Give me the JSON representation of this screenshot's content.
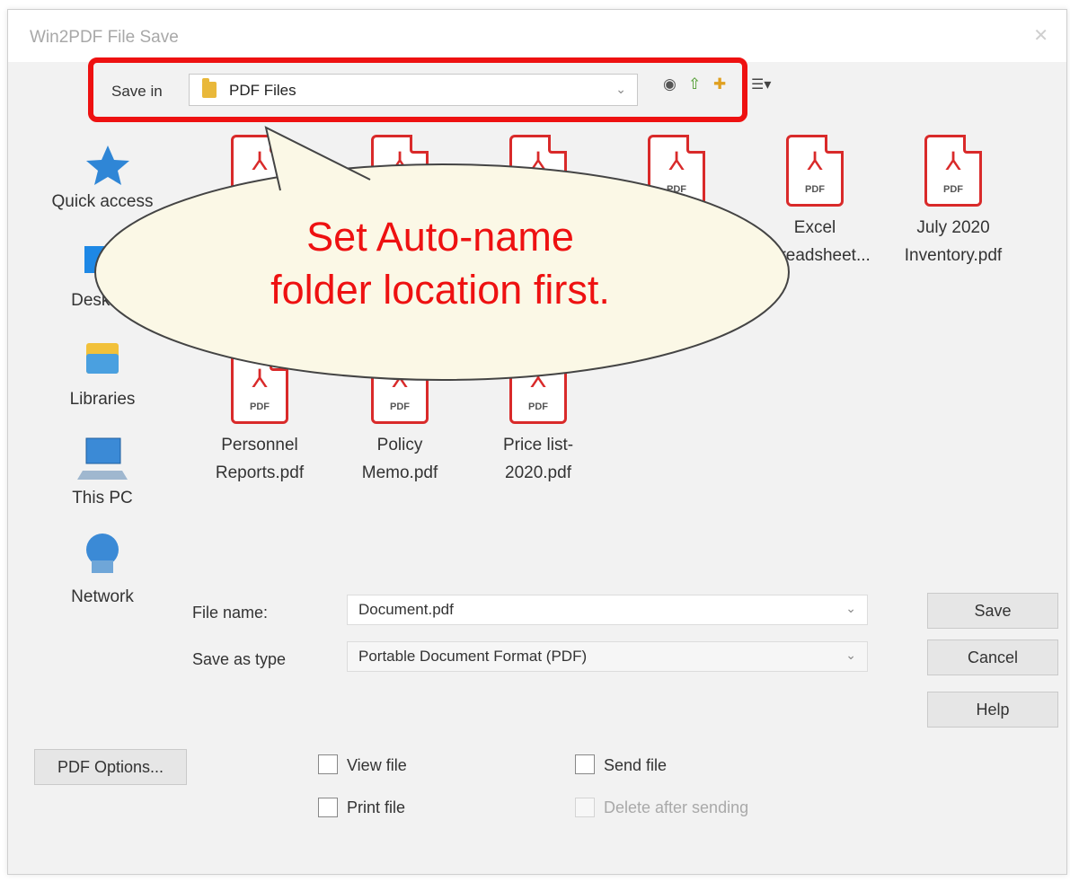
{
  "window": {
    "title": "Win2PDF File Save"
  },
  "toolbar": {
    "save_in_label": "Save in",
    "path": "PDF Files",
    "icons": [
      "back-icon",
      "up-folder-icon",
      "new-folder-icon",
      "view-menu-icon"
    ]
  },
  "places": [
    {
      "name": "quick-access",
      "label": "Quick access",
      "icon": "star-icon"
    },
    {
      "name": "desktop",
      "label": "Desktop",
      "icon": "desktop-icon"
    },
    {
      "name": "libraries",
      "label": "Libraries",
      "icon": "libraries-icon"
    },
    {
      "name": "this-pc",
      "label": "This PC",
      "icon": "computer-icon"
    },
    {
      "name": "network",
      "label": "Network",
      "icon": "network-icon"
    }
  ],
  "files": [
    {
      "line1": "",
      "line2": ""
    },
    {
      "line1": "",
      "line2": ""
    },
    {
      "line1": "",
      "line2": ""
    },
    {
      "line1": "",
      "line2": ""
    },
    {
      "line1": "Excel",
      "line2": "Spreadsheet..."
    },
    {
      "line1": "July 2020",
      "line2": "Inventory.pdf"
    },
    {
      "line1": "Personnel",
      "line2": "Reports.pdf"
    },
    {
      "line1": "Policy",
      "line2": "Memo.pdf"
    },
    {
      "line1": "Price list-",
      "line2": "2020.pdf"
    }
  ],
  "file_icon_tag": "PDF",
  "callout": {
    "line1": "Set Auto-name",
    "line2": "folder location first."
  },
  "form": {
    "file_name_label": "File name:",
    "file_name_value": "Document.pdf",
    "save_type_label": "Save as type",
    "save_type_value": "Portable Document Format (PDF)"
  },
  "buttons": {
    "save": "Save",
    "cancel": "Cancel",
    "help": "Help",
    "pdf_options": "PDF Options..."
  },
  "options": {
    "view_file": "View file",
    "print_file": "Print file",
    "send_file": "Send file",
    "delete_after_sending": "Delete after sending"
  },
  "colors": {
    "highlight": "#ee1111",
    "pdf_red": "#d92a2a",
    "callout_fill": "#fbf8e6"
  }
}
